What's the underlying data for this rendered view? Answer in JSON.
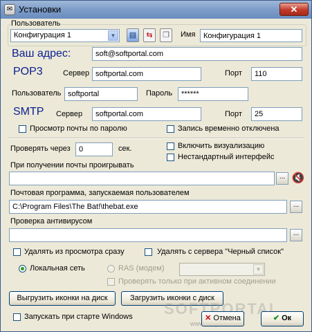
{
  "window": {
    "title": "Установки",
    "close_label": "✕"
  },
  "user_group": {
    "title": "Пользователь",
    "config_selected": "Конфигурация 1",
    "name_label": "Имя",
    "name_value": "Конфигурация 1"
  },
  "address": {
    "label": "Ваш адрес:",
    "value": "soft@softportal.com"
  },
  "pop3": {
    "label": "POP3",
    "server_label": "Сервер",
    "server_value": "softportal.com",
    "port_label": "Порт",
    "port_value": "110",
    "user_label": "Пользователь",
    "user_value": "softportal",
    "password_label": "Пароль",
    "password_value": "******"
  },
  "smtp": {
    "label": "SMTP",
    "server_label": "Сервер",
    "server_value": "softportal.com",
    "port_label": "Порт",
    "port_value": "25"
  },
  "checks": {
    "view_by_password": "Просмотр почты по паролю",
    "recording_disabled": "Запись временно отключена",
    "enable_visualization": "Включить визуализацию",
    "nonstandard_interface": "Нестандартный интерфейс",
    "delete_from_view": "Удалять из просмотра сразу",
    "delete_from_server": "Удалять с сервера \"Черный список\"",
    "check_only_when_active": "Проверять только при активном соединении",
    "run_at_startup": "Запускать при старте Windows"
  },
  "check_every": {
    "label": "Проверять через",
    "value": "0",
    "unit": "сек."
  },
  "play_on_mail": {
    "label": "При получении почты проигрывать",
    "value": ""
  },
  "mail_program": {
    "label": "Почтовая программа, запускаемая пользователем",
    "value": "C:\\Program Files\\The Bat!\\thebat.exe"
  },
  "antivirus": {
    "label": "Проверка антивирусом",
    "value": ""
  },
  "network": {
    "local_label": "Локальная сеть",
    "ras_label": "RAS (модем)",
    "ras_value": ""
  },
  "buttons": {
    "browse": "...",
    "export_icons": "Выгрузить иконки на диск",
    "import_icons": "Загрузить иконки с диск",
    "cancel": "Отмена",
    "ok": "Ок"
  },
  "watermark": {
    "line1": "SOFTPORTAL",
    "line2": "www.softportal.com"
  }
}
